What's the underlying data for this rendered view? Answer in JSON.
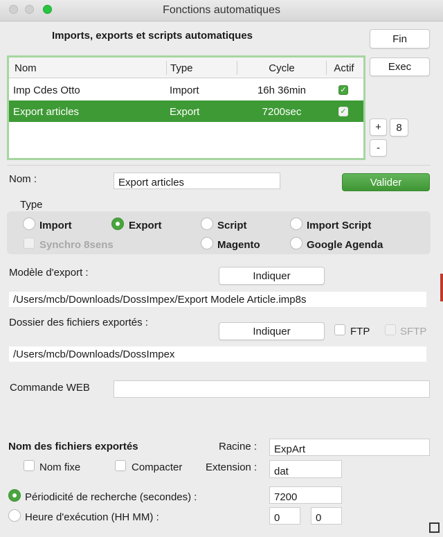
{
  "window": {
    "title": "Fonctions automatiques"
  },
  "header": {
    "title": "Imports, exports et scripts automatiques"
  },
  "buttons": {
    "fin": "Fin",
    "exec": "Exec",
    "plus": "+",
    "count": "8",
    "minus": "-",
    "valider": "Valider"
  },
  "table": {
    "columns": [
      "Nom",
      "Type",
      "Cycle",
      "Actif"
    ],
    "rows": [
      {
        "nom": "Imp Cdes Otto",
        "type": "Import",
        "cycle": "16h 36min",
        "actif": true
      },
      {
        "nom": "Export articles",
        "type": "Export",
        "cycle": "7200sec",
        "actif": true
      }
    ]
  },
  "nom": {
    "label": "Nom :",
    "value": "Export articles"
  },
  "type": {
    "label": "Type",
    "options": [
      "Import",
      "Export",
      "Script",
      "Import Script",
      "Magento",
      "Google Agenda"
    ],
    "selected": "Export",
    "synchro_label": "Synchro 8sens"
  },
  "export_model": {
    "label": "Modèle d'export :",
    "button": "Indiquer",
    "path": "/Users/mcb/Downloads/DossImpex/Export Modele Article.imp8s"
  },
  "export_folder": {
    "label": "Dossier des fichiers exportés :",
    "button": "Indiquer",
    "ftp_label": "FTP",
    "sftp_label": "SFTP",
    "path": "/Users/mcb/Downloads/DossImpex"
  },
  "web": {
    "label": "Commande WEB",
    "value": ""
  },
  "exported_names": {
    "title": "Nom des fichiers exportés",
    "racine_label": "Racine :",
    "racine_value": "ExpArt",
    "nom_fixe_label": "Nom fixe",
    "compacter_label": "Compacter",
    "extension_label": "Extension :",
    "extension_value": "dat"
  },
  "schedule": {
    "periodicity_label": "Périodicité de recherche (secondes) :",
    "periodicity_value": "7200",
    "hour_label": "Heure d'exécution (HH MM) :",
    "hour_value": "0",
    "minute_value": "0",
    "selected": "periodicity"
  },
  "colors": {
    "accent": "#3e9a35",
    "selection_border": "#a6d6a0"
  }
}
